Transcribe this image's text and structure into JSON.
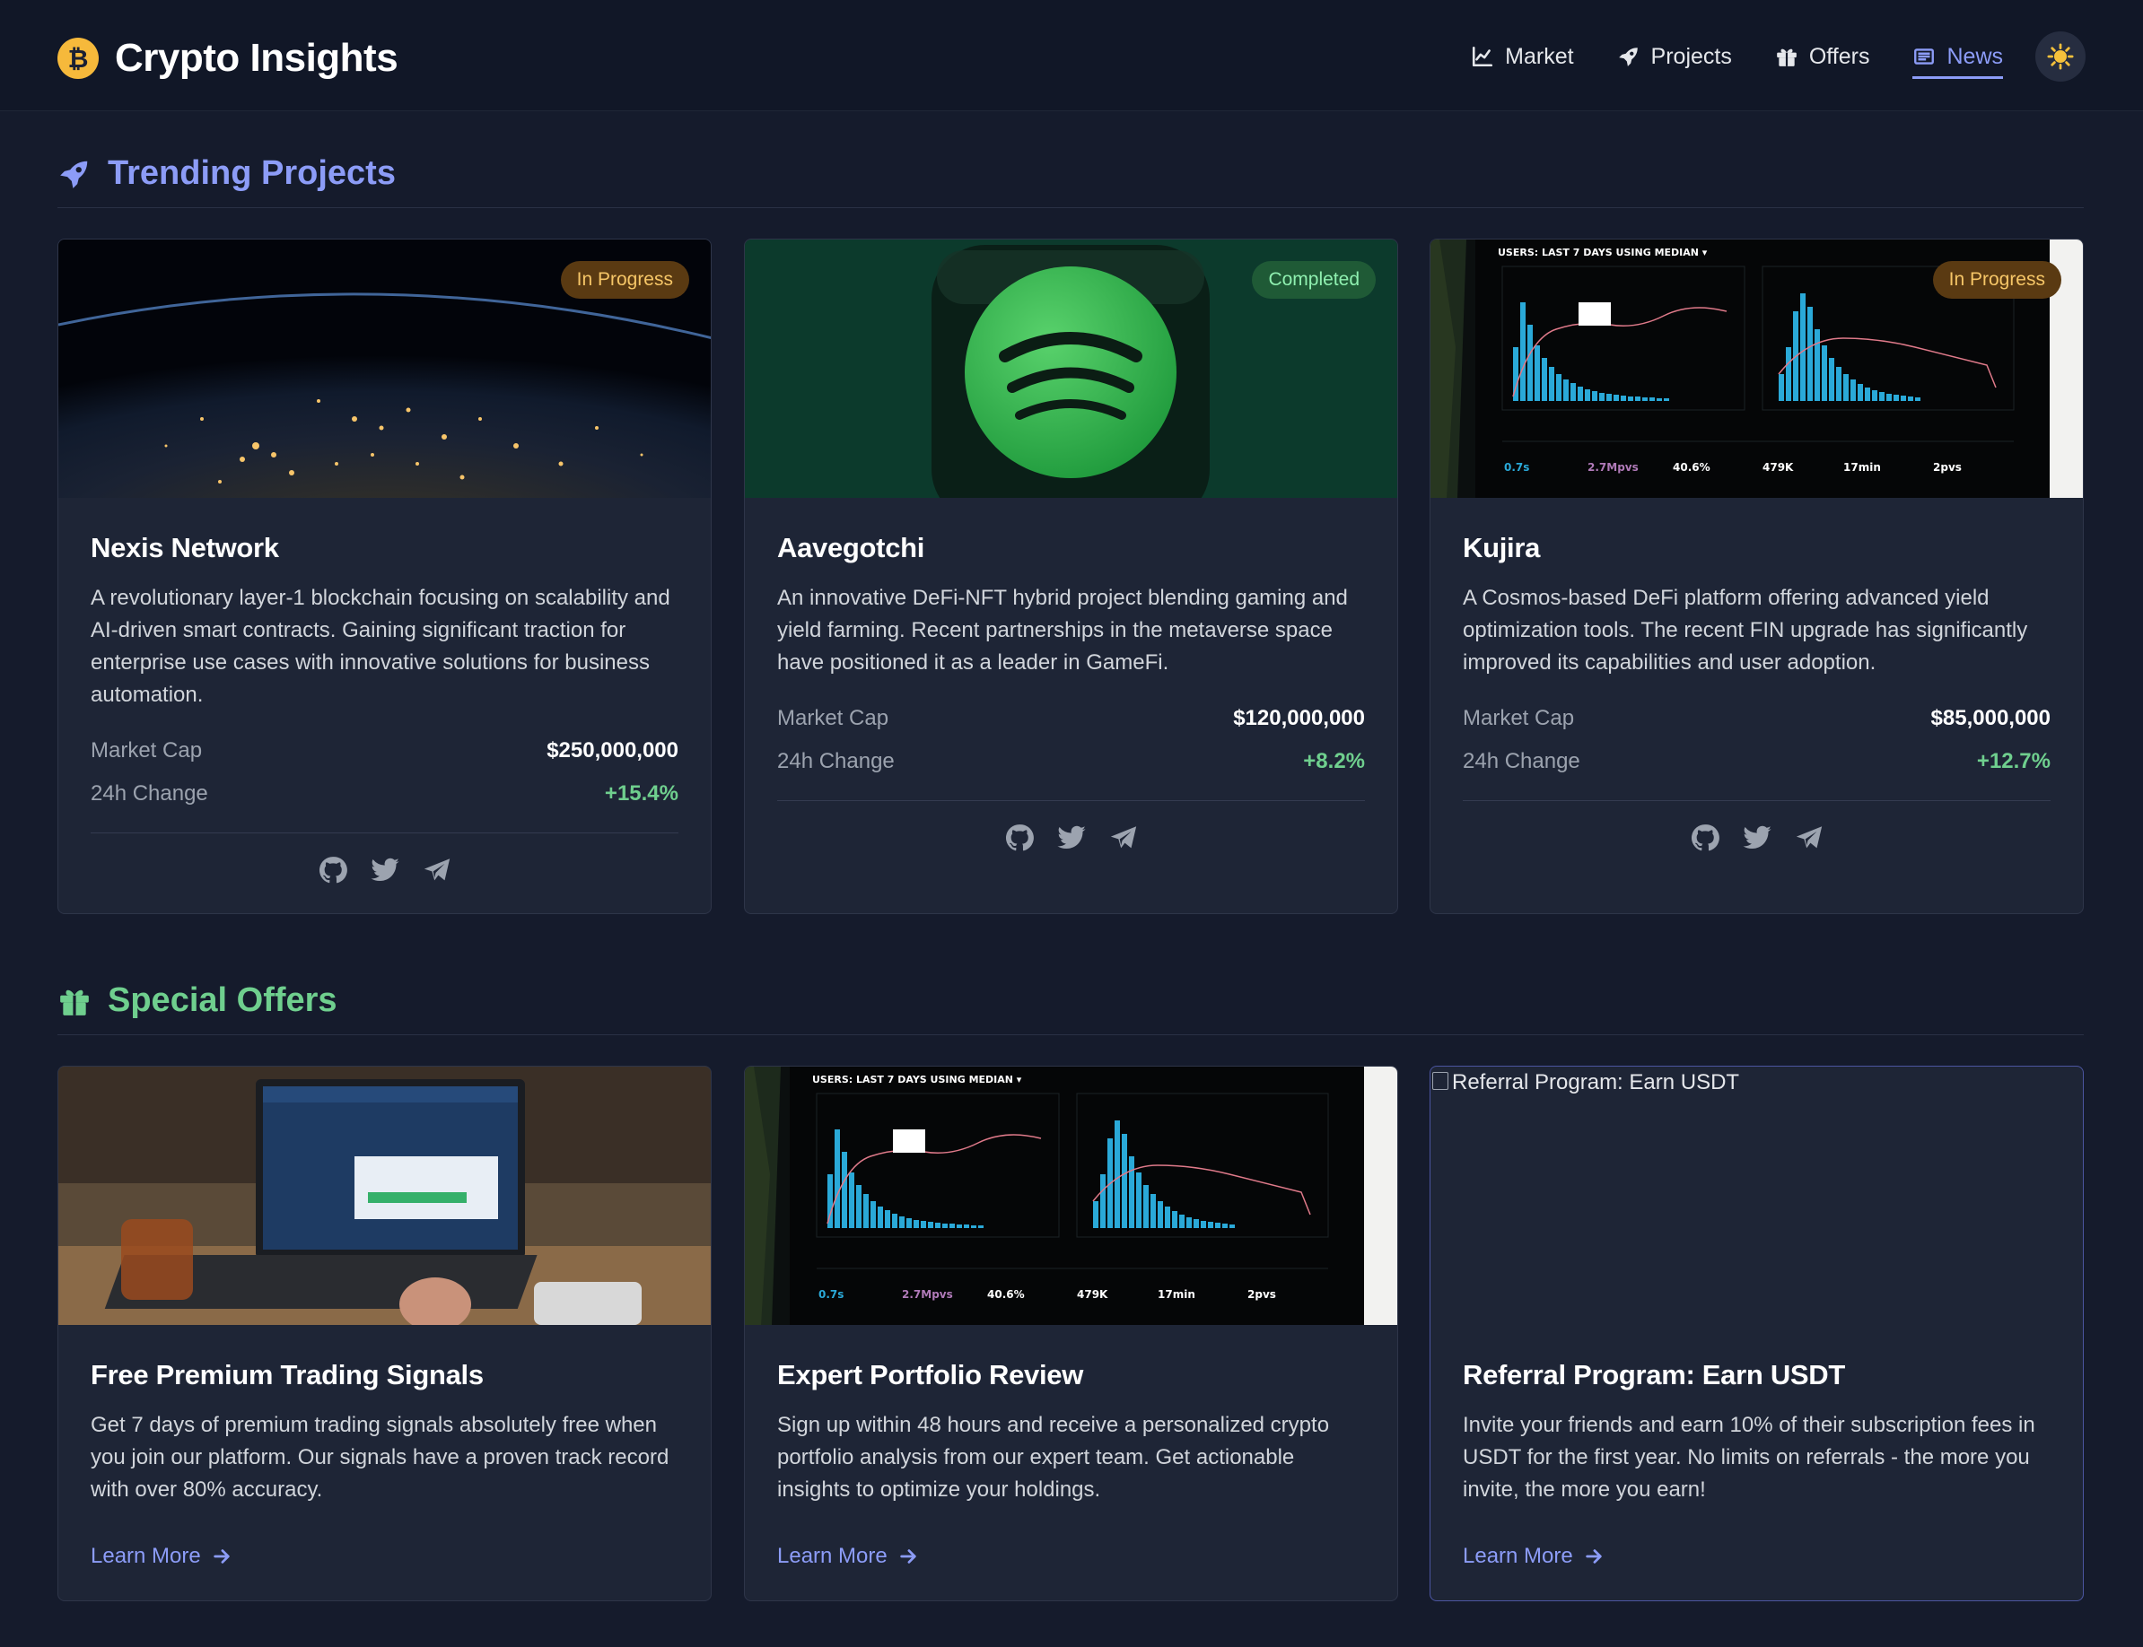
{
  "header": {
    "brand_symbol": "₿",
    "title": "Crypto Insights",
    "nav": [
      {
        "label": "Market",
        "icon": "chart-line-icon"
      },
      {
        "label": "Projects",
        "icon": "rocket-icon"
      },
      {
        "label": "Offers",
        "icon": "gift-icon"
      },
      {
        "label": "News",
        "icon": "newspaper-icon",
        "active": true
      }
    ],
    "theme_icon": "sun-icon"
  },
  "projects": {
    "title": "Trending Projects",
    "icon": "rocket-icon",
    "stat_labels": {
      "market_cap": "Market Cap",
      "change": "24h Change"
    },
    "items": [
      {
        "status": "In Progress",
        "name": "Nexis Network",
        "description": "A revolutionary layer-1 blockchain focusing on scalability and AI-driven smart contracts. Gaining significant traction for enterprise use cases with innovative solutions for business automation.",
        "market_cap": "$250,000,000",
        "change": "+15.4%",
        "image": "earth-night-lights"
      },
      {
        "status": "Completed",
        "name": "Aavegotchi",
        "description": "An innovative DeFi-NFT hybrid project blending gaming and yield farming. Recent partnerships in the metaverse space have positioned it as a leader in GameFi.",
        "market_cap": "$120,000,000",
        "change": "+8.2%",
        "image": "spotify-app-icon"
      },
      {
        "status": "In Progress",
        "name": "Kujira",
        "description": "A Cosmos-based DeFi platform offering advanced yield optimization tools. The recent FIN upgrade has significantly improved its capabilities and user adoption.",
        "market_cap": "$85,000,000",
        "change": "+12.7%",
        "image": "analytics-dashboard"
      }
    ],
    "social_icons": [
      "github-icon",
      "twitter-icon",
      "telegram-icon"
    ]
  },
  "offers": {
    "title": "Special Offers",
    "icon": "gift-icon",
    "learn_more": "Learn More",
    "items": [
      {
        "title": "Free Premium Trading Signals",
        "description": "Get 7 days of premium trading signals absolutely free when you join our platform. Our signals have a proven track record with over 80% accuracy.",
        "image": "laptop-revenue"
      },
      {
        "title": "Expert Portfolio Review",
        "description": "Sign up within 48 hours and receive a personalized crypto portfolio analysis from our expert team. Get actionable insights to optimize your holdings.",
        "image": "analytics-dashboard"
      },
      {
        "title": "Referral Program: Earn USDT",
        "image_alt": "Referral Program: Earn USDT",
        "description": "Invite your friends and earn 10% of their subscription fees in USDT for the first year. No limits on referrals - the more you invite, the more you earn!",
        "image": "broken-image"
      }
    ]
  },
  "colors": {
    "background": "#151b2c",
    "card": "#1e2536",
    "accent": "#8c9cf7",
    "positive": "#6fcf8e",
    "badge_progress": "#f6c667",
    "badge_completed": "#8ff0b0"
  }
}
